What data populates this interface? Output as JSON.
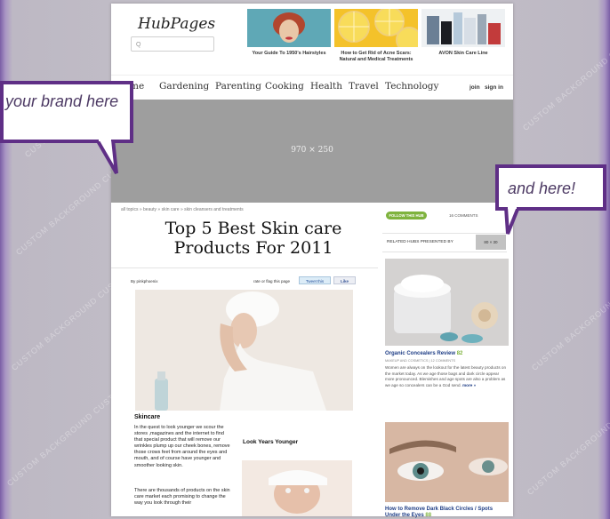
{
  "watermark": "CUSTOM BACKGROUND CUSTOM BACKGROUND",
  "header": {
    "logo": "HubPages",
    "search_placeholder": "Q"
  },
  "ads": [
    {
      "caption": "Your Guide To 1950's Hairstyles"
    },
    {
      "caption": "How to Get Rid of Acne Scars: Natural and Medical Treatments"
    },
    {
      "caption": "AVON Skin Care Line"
    }
  ],
  "nav": {
    "items": [
      "me",
      "Gardening",
      "Parenting",
      "Cooking",
      "Health",
      "Travel",
      "Technology"
    ],
    "join": "join",
    "sign_in": "sign in"
  },
  "banner": {
    "size": "970 × 250"
  },
  "callouts": {
    "left": "your brand here",
    "right": "and here!"
  },
  "article": {
    "breadcrumb": "all topics » beauty » skin care » skin cleansers and treatments",
    "title": "Top 5 Best Skin care Products For 2011",
    "byline": "By pinkphoenix",
    "rate": "rate or flag this page",
    "tweet": "Tweet this",
    "like": "Like",
    "skincare_heading": "Skincare",
    "para1": "In the quest to look younger we scour the stores ,magazines and the internet to find that special product that will remove our wrinkles plump up our cheek bones, remove those crows feet from around the eyes and mouth, and of course have younger and smoother looking skin.",
    "para2": "There are thousands of products on the skin care market each promising to change the way you look through their",
    "look_heading": "Look Years Younger"
  },
  "sidebar": {
    "follow_button": "FOLLOW THIS HUB",
    "comments": "16 COMMENTS",
    "related_label": "RELATED HUBS PRESENTED BY",
    "sponsor_size": "80 × 30",
    "hub1": {
      "title": "Organic Concealers Review",
      "score": "82",
      "meta": "MAKEUP AND COSMETICS | 12 COMMENTS",
      "text": "Women are always on the lookout for the latest beauty products on the market today. As we age those bags and dark circle appear more pronounced. Blemishes and age spots are also a problem as we age so concealers can be a God send.",
      "more": "more »"
    },
    "hub2": {
      "title": "How to Remove Dark Black Circles / Spots Under the Eyes",
      "score": "88"
    }
  }
}
